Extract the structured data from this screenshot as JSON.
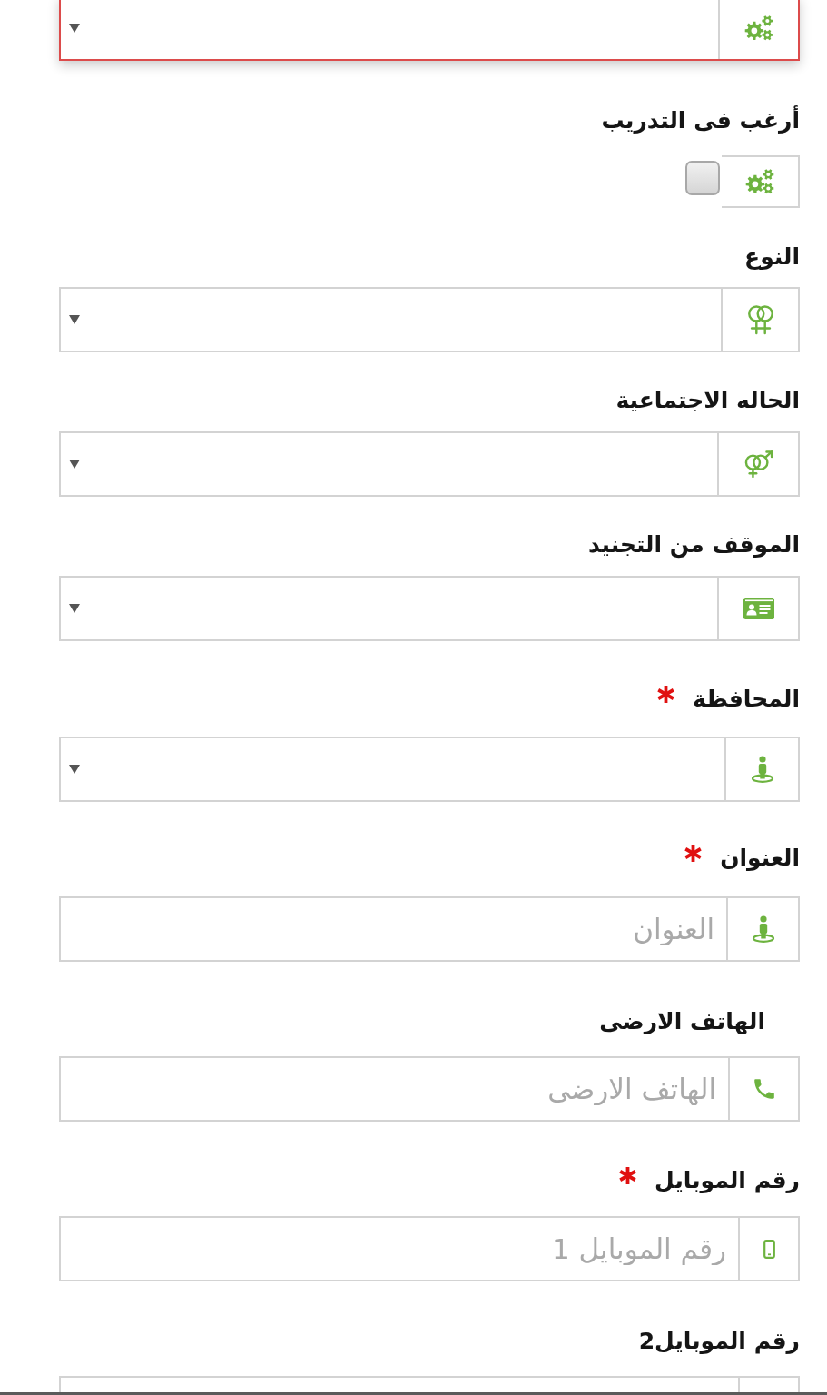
{
  "fields": [
    {
      "kind": "select",
      "invalid": true
    },
    {
      "kind": "checkbox",
      "label": "أرغب فى التدريب",
      "required": false,
      "checked": false
    },
    {
      "kind": "select",
      "label": "النوع",
      "required": false,
      "invalid": false
    },
    {
      "kind": "select",
      "label": "الحاله الاجتماعية",
      "required": false,
      "invalid": false
    },
    {
      "kind": "select",
      "label": "الموقف من التجنيد",
      "required": false,
      "invalid": false
    },
    {
      "kind": "select",
      "label": "المحافظة",
      "required": true,
      "invalid": false
    },
    {
      "kind": "text",
      "label": "العنوان",
      "required": true,
      "invalid": false,
      "placeholder": "العنوان"
    },
    {
      "kind": "text",
      "label": "الهاتف الارضى",
      "required": false,
      "invalid": false,
      "placeholder": "الهاتف الارضى"
    },
    {
      "kind": "text",
      "label": "رقم الموبايل",
      "required": true,
      "invalid": false,
      "placeholder": "رقم الموبايل 1"
    },
    {
      "kind": "text",
      "label": "رقم الموبايل2",
      "required": false,
      "invalid": false
    }
  ]
}
